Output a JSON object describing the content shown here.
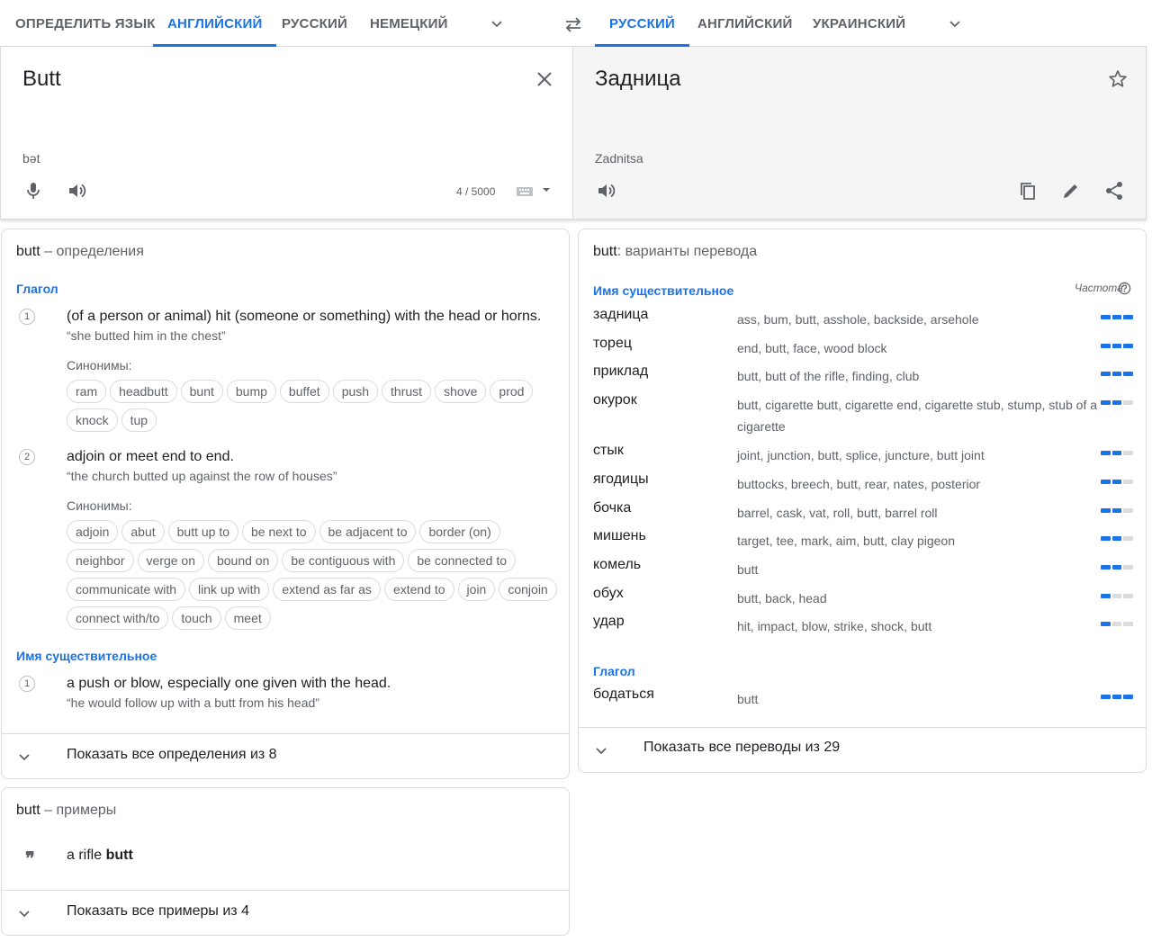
{
  "source_langs": {
    "detect": "ОПРЕДЕЛИТЬ ЯЗЫК",
    "english": "АНГЛИЙСКИЙ",
    "russian": "РУССКИЙ",
    "german": "НЕМЕЦКИЙ"
  },
  "target_langs": {
    "russian": "РУССКИЙ",
    "english": "АНГЛИЙСКИЙ",
    "ukrainian": "УКРАИНСКИЙ"
  },
  "source": {
    "text": "Butt",
    "transcription": "bət",
    "counter": "4 / 5000"
  },
  "target": {
    "text": "Задница",
    "transliteration": "Zadnitsa"
  },
  "definitions": {
    "word": "butt",
    "title_suffix": " – определения",
    "verb_label": "Глагол",
    "noun_label": "Имя существительное",
    "synonyms_label": "Синонимы:",
    "verb_defs": [
      {
        "num": "1",
        "text": "(of a person or animal) hit (someone or something) with the head or horns.",
        "example": "“she butted him in the chest”",
        "synonyms": [
          "ram",
          "headbutt",
          "bunt",
          "bump",
          "buffet",
          "push",
          "thrust",
          "shove",
          "prod",
          "knock",
          "tup"
        ]
      },
      {
        "num": "2",
        "text": "adjoin or meet end to end.",
        "example": "“the church butted up against the row of houses”",
        "synonyms": [
          "adjoin",
          "abut",
          "butt up to",
          "be next to",
          "be adjacent to",
          "border (on)",
          "neighbor",
          "verge on",
          "bound on",
          "be contiguous with",
          "be connected to",
          "communicate with",
          "link up with",
          "extend as far as",
          "extend to",
          "join",
          "conjoin",
          "connect with/to",
          "touch",
          "meet"
        ]
      }
    ],
    "noun_defs": [
      {
        "num": "1",
        "text": "a push or blow, especially one given with the head.",
        "example": "“he would follow up with a butt from his head”"
      }
    ],
    "show_all": "Показать все определения из 8"
  },
  "examples": {
    "word": "butt",
    "title_suffix": " – примеры",
    "items": [
      {
        "before": "a rifle ",
        "bold": "butt"
      }
    ],
    "show_all": "Показать все примеры из 4"
  },
  "translations": {
    "word": "butt",
    "title_suffix": ": варианты перевода",
    "noun_label": "Имя существительное",
    "verb_label": "Глагол",
    "frequency_label": "Частота",
    "noun_rows": [
      {
        "word": "задница",
        "reverse": "ass, bum, butt, asshole, backside, arsehole",
        "freq": 3
      },
      {
        "word": "торец",
        "reverse": "end, butt, face, wood block",
        "freq": 3
      },
      {
        "word": "приклад",
        "reverse": "butt, butt of the rifle, finding, club",
        "freq": 3
      },
      {
        "word": "окурок",
        "reverse": "butt, cigarette butt, cigarette end, cigarette stub, stump, stub of a cigarette",
        "freq": 2
      },
      {
        "word": "стык",
        "reverse": "joint, junction, butt, splice, juncture, butt joint",
        "freq": 2
      },
      {
        "word": "ягодицы",
        "reverse": "buttocks, breech, butt, rear, nates, posterior",
        "freq": 2
      },
      {
        "word": "бочка",
        "reverse": "barrel, cask, vat, roll, butt, barrel roll",
        "freq": 2
      },
      {
        "word": "мишень",
        "reverse": "target, tee, mark, aim, butt, clay pigeon",
        "freq": 2
      },
      {
        "word": "комель",
        "reverse": "butt",
        "freq": 2
      },
      {
        "word": "обух",
        "reverse": "butt, back, head",
        "freq": 1
      },
      {
        "word": "удар",
        "reverse": "hit, impact, blow, strike, shock, butt",
        "freq": 1
      }
    ],
    "verb_rows": [
      {
        "word": "бодаться",
        "reverse": "butt",
        "freq": 3
      }
    ],
    "show_all": "Показать все переводы из 29"
  },
  "icons": {
    "swap": "swap-arrows-icon",
    "clear": "close-icon",
    "mic": "microphone-icon",
    "speaker": "speaker-icon",
    "keyboard": "keyboard-icon",
    "star": "star-icon",
    "copy": "copy-icon",
    "edit": "pencil-icon",
    "share": "share-icon",
    "help": "help-icon",
    "quote": "quote-icon"
  },
  "colors": {
    "accent": "#1a73e8",
    "muted_text": "#5f6368",
    "target_panel_bg": "#f5f5f5",
    "border": "#dadce0"
  }
}
